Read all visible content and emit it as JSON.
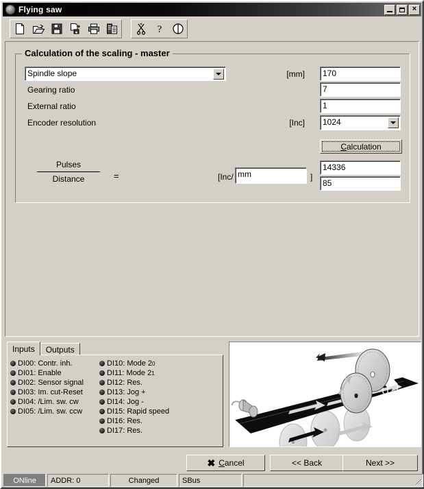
{
  "window": {
    "title": "Flying saw",
    "icon": "app-circle-icon",
    "controls": {
      "minimize": "minimize",
      "maximize": "maximize",
      "close": "×"
    }
  },
  "toolbar": {
    "group1": [
      {
        "name": "new-file-icon",
        "label": "New"
      },
      {
        "name": "open-folder-icon",
        "label": "Open"
      },
      {
        "name": "save-disk-icon",
        "label": "Save"
      },
      {
        "name": "save-as-icon",
        "label": "Save as"
      },
      {
        "name": "print-icon",
        "label": "Print"
      },
      {
        "name": "copy-paste-icon",
        "label": "Copy"
      }
    ],
    "group2": [
      {
        "name": "scissors-cut-icon",
        "label": "Cut"
      },
      {
        "name": "help-question-icon",
        "label": "Help"
      },
      {
        "name": "info-contrast-icon",
        "label": "Info"
      }
    ]
  },
  "group": {
    "title": "Calculation of the scaling - master"
  },
  "form": {
    "rows": [
      {
        "label": "Spindle slope",
        "type": "combo",
        "unit": "[mm]",
        "value": "170"
      },
      {
        "label": "Gearing ratio",
        "type": "text",
        "unit": "",
        "value": "7"
      },
      {
        "label": "External ratio",
        "type": "text",
        "unit": "",
        "value": "1"
      },
      {
        "label": "Encoder resolution",
        "type": "text",
        "unit": "[Inc]",
        "value": "1024"
      }
    ],
    "calculation_button": {
      "label": "Calculation",
      "accel": "C"
    },
    "fraction": {
      "numerator": "Pulses",
      "denominator": "Distance",
      "equals": "="
    },
    "unit_prefix": "[Inc/",
    "unit_suffix": "]",
    "unit_value": "mm",
    "result_numerator": "14336",
    "result_denominator": "85"
  },
  "tabs": {
    "items": [
      {
        "label": "Inputs",
        "active": true
      },
      {
        "label": "Outputs",
        "active": false
      }
    ]
  },
  "io": {
    "left_column": [
      "DI00: Contr. inh.",
      "DI01: Enable",
      "DI02: Sensor signal",
      "DI03: Im. cut-Reset",
      "DI04: /Lim. sw. cw",
      "DI05: /Lim. sw. ccw"
    ],
    "right_column": [
      "DI10: Mode 2",
      "DI11: Mode 2",
      "DI12: Res.",
      "DI13: Jog +",
      "DI14: Jog -",
      "DI15: Rapid speed",
      "DI16: Res.",
      "DI17: Res."
    ],
    "right_column_superscripts": [
      "0",
      "1",
      "",
      "",
      "",
      "",
      "",
      ""
    ]
  },
  "illustration": {
    "name": "flying-saw-conveyor-diagram",
    "description": "Conveyor belt with rotating circular saw blades and motion arrows"
  },
  "buttons": {
    "cancel": {
      "label": "Cancel",
      "accel": "C",
      "icon": "x-mark-icon"
    },
    "back": {
      "label": "<< Back"
    },
    "next": {
      "label": "Next >>"
    }
  },
  "statusbar": {
    "online": "ONline",
    "address": "ADDR: 0",
    "changed": "Changed",
    "bus": "SBus",
    "extra": ""
  }
}
